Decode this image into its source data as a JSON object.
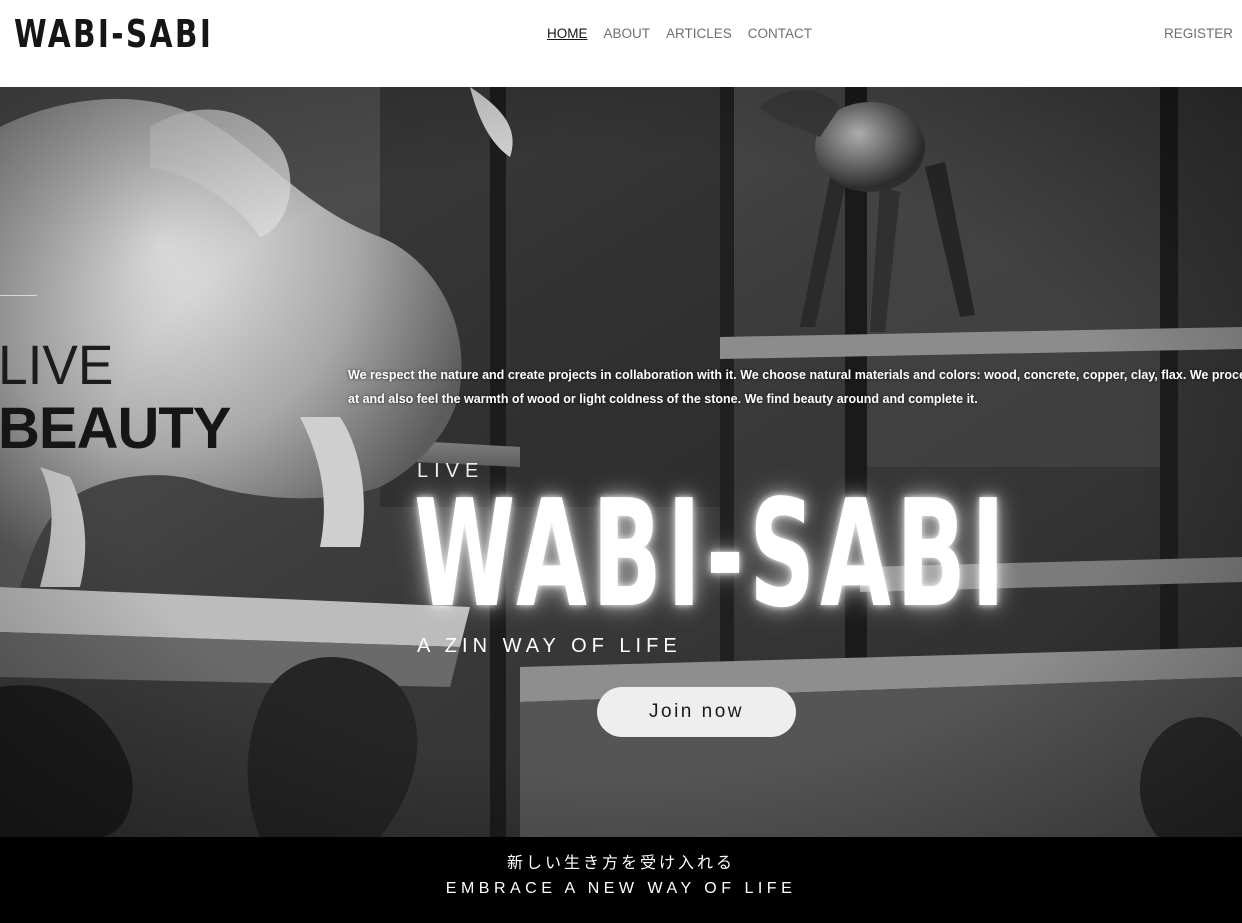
{
  "header": {
    "logo": "WABI-SABI",
    "nav": [
      {
        "label": "HOME",
        "active": true
      },
      {
        "label": "ABOUT",
        "active": false
      },
      {
        "label": "ARTICLES",
        "active": false
      },
      {
        "label": "CONTACT",
        "active": false
      }
    ],
    "register_label": "REGISTER"
  },
  "hero": {
    "side_live": "LIVE",
    "side_beauty": "BEAUTY",
    "blurb": "We respect the nature and create projects in collaboration with it. We choose natural materials and colors: wood, concrete, copper, clay, flax. We process the textures. It's a thing to look at and also feel the warmth of wood or light coldness of the stone. We find beauty around and complete it.",
    "kicker": "LIVE",
    "title": "WABI-SABI",
    "tagline": "A ZIN WAY OF LIFE",
    "cta_label": "Join now"
  },
  "band": {
    "japanese": "新しい生き方を受け入れる",
    "english": "EMBRACE A NEW WAY OF LIFE"
  },
  "colors": {
    "header_bg": "#ffffff",
    "logo": "#161616",
    "nav_inactive": "#6f6f6f",
    "band_bg": "#000000",
    "button_bg": "#eeeeee"
  }
}
